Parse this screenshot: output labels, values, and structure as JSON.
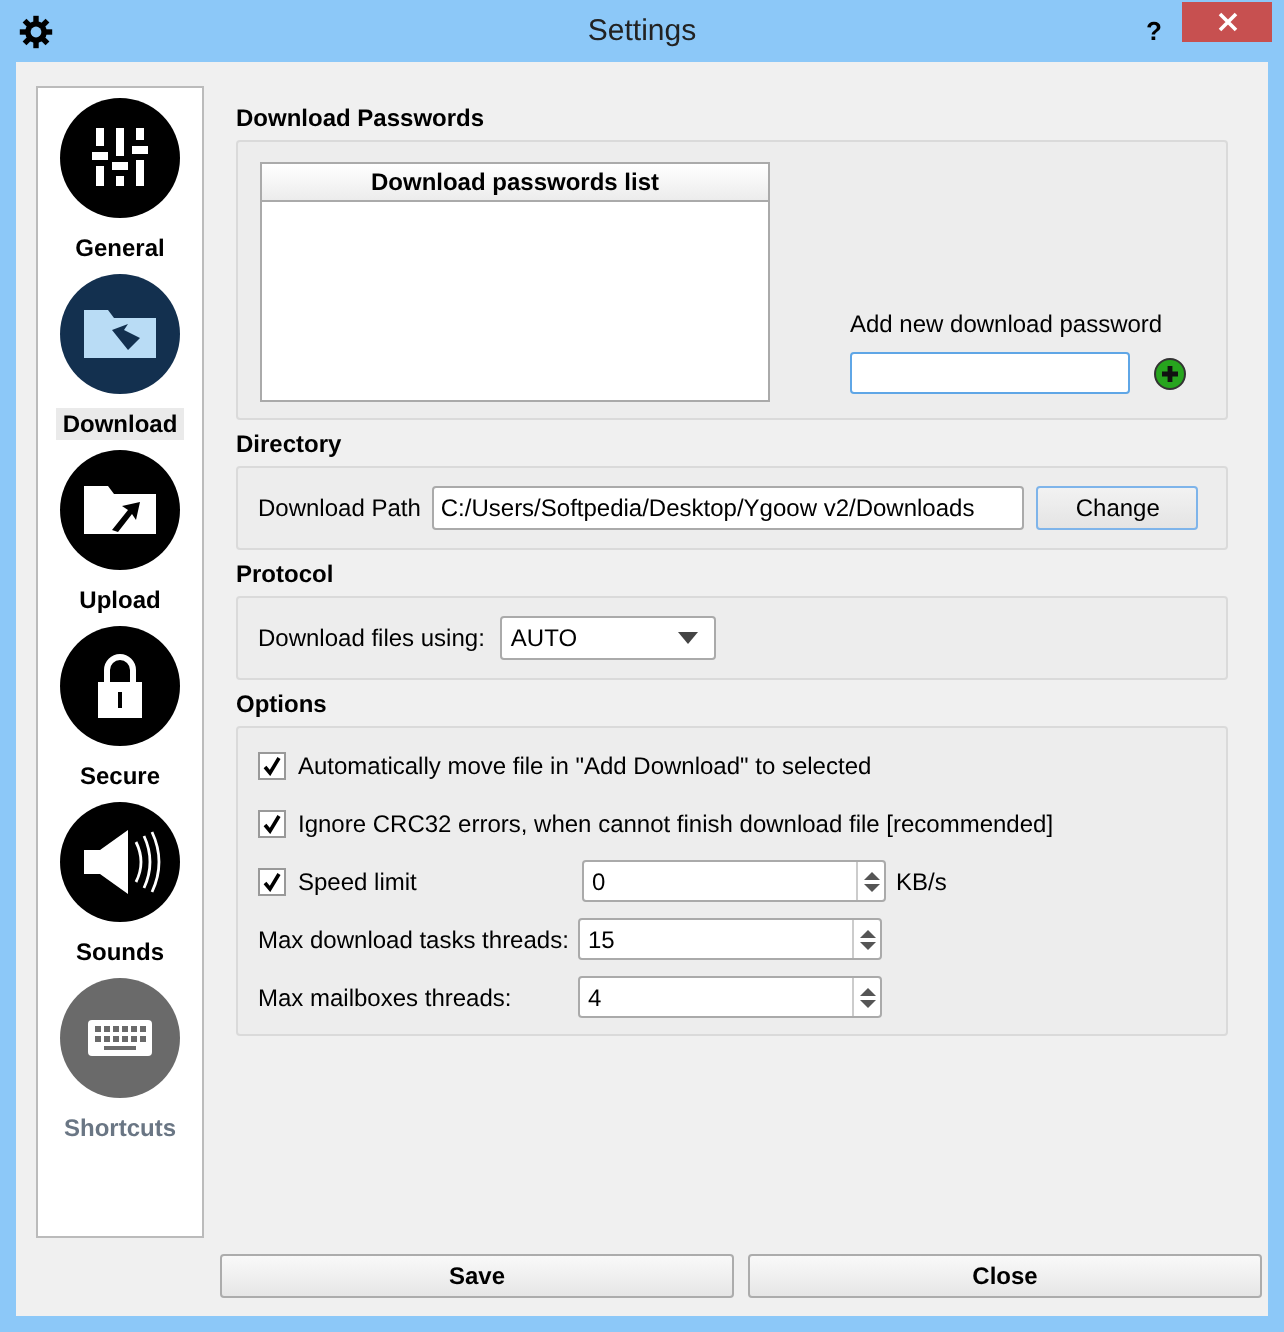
{
  "window": {
    "title": "Settings",
    "help": "?"
  },
  "sidebar": {
    "items": [
      {
        "label": "General",
        "selected": false,
        "disabled": false
      },
      {
        "label": "Download",
        "selected": true,
        "disabled": false
      },
      {
        "label": "Upload",
        "selected": false,
        "disabled": false
      },
      {
        "label": "Secure",
        "selected": false,
        "disabled": false
      },
      {
        "label": "Sounds",
        "selected": false,
        "disabled": false
      },
      {
        "label": "Shortcuts",
        "selected": false,
        "disabled": true
      }
    ]
  },
  "download_passwords": {
    "heading": "Download Passwords",
    "list_header": "Download passwords list",
    "add_label": "Add new download password"
  },
  "directory": {
    "heading": "Directory",
    "label": "Download Path",
    "value": "C:/Users/Softpedia/Desktop/Ygoow v2/Downloads",
    "button": "Change"
  },
  "protocol": {
    "heading": "Protocol",
    "label": "Download files using:",
    "value": "AUTO"
  },
  "options": {
    "heading": "Options",
    "rows": [
      {
        "kind": "checkbox",
        "label": "Automatically move file in \"Add Download\" to selected",
        "checked": true
      },
      {
        "kind": "checkbox",
        "label": "Ignore CRC32 errors, when cannot finish download file [recommended]",
        "checked": true
      },
      {
        "kind": "checkbox-spin",
        "label": "Speed limit",
        "checked": true,
        "value": "0",
        "unit": "KB/s"
      },
      {
        "kind": "spin",
        "label": "Max download tasks threads:",
        "value": "15"
      },
      {
        "kind": "spin",
        "label": "Max mailboxes threads:",
        "value": "4"
      }
    ]
  },
  "buttons": [
    "Save",
    "Close"
  ]
}
